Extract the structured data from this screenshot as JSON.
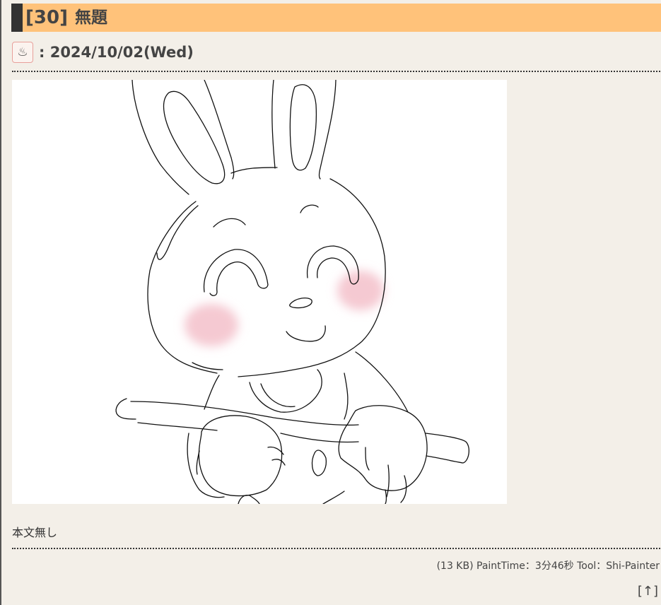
{
  "post": {
    "number": "[30]",
    "title": "無題",
    "date": ": 2024/10/02(Wed)",
    "icon": "hot-springs-icon",
    "icon_glyph": "♨",
    "comment": "本文無し",
    "file_info": "(13 KB) PaintTime：3分46秒 Tool：Shi-Painter",
    "to_top": "[↑]"
  },
  "colors": {
    "header_bg": "#ffc27a",
    "header_bar": "#333333",
    "page_bg": "#f3efe8",
    "cheek": "#f6d0d8"
  }
}
